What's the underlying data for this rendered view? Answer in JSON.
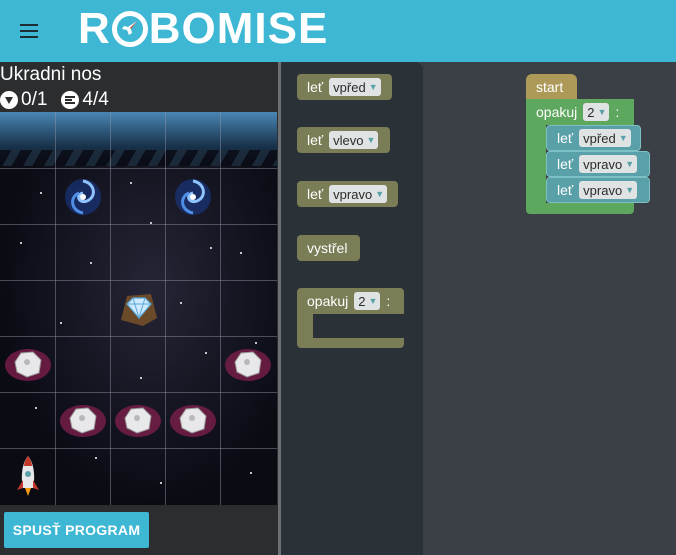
{
  "header": {
    "logo_text_1": "R",
    "logo_text_2": "BOMISE"
  },
  "level": {
    "title": "Ukradni nos",
    "gems": "0/1",
    "blocks": "4/4"
  },
  "run_button": "SPUSŤ PROGRAM",
  "toolbox": {
    "forward": {
      "label": "leť",
      "value": "vpřed"
    },
    "left": {
      "label": "leť",
      "value": "vlevo"
    },
    "right": {
      "label": "leť",
      "value": "vpravo"
    },
    "shoot": {
      "label": "vystřel"
    },
    "repeat": {
      "label": "opakuj",
      "value": "2",
      "suffix": ":"
    }
  },
  "program": {
    "start": "start",
    "repeat": {
      "label": "opakuj",
      "value": "2",
      "suffix": ":"
    },
    "steps": [
      {
        "label": "leť",
        "value": "vpřed"
      },
      {
        "label": "leť",
        "value": "vpravo"
      },
      {
        "label": "leť",
        "value": "vpravo"
      }
    ]
  },
  "colors": {
    "accent": "#3db7d3",
    "move_block": "#5aa0a8",
    "loop_block": "#5da85e",
    "start_block": "#ad9a59",
    "toolbox_block": "#7b7d56"
  },
  "board_items": [
    "wormhole-icon",
    "wormhole-icon",
    "diamond-icon",
    "asteroid-icon",
    "asteroid-icon",
    "asteroid-icon",
    "asteroid-icon",
    "asteroid-icon",
    "rocket-icon"
  ]
}
